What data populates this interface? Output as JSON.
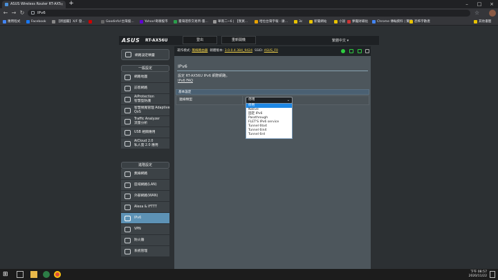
{
  "browser": {
    "tab_title": "ASUS Wireless Router RT-AX5",
    "url": "IPv6",
    "bookmarks": [
      "應用程式",
      "Facebook",
      "【新國屬】X/F 發...",
      "Goodinfo!台灣股...",
      "Yahoo!奇摩股市",
      "臺灣證券交易所-臺...",
      "華南二~6 | 【我買...",
      "哈拉台灣字報 - 康...",
      "3c",
      "新聞網站",
      "小說",
      "夢魘財補帖",
      "Chrome 傳輸資料 | 實家",
      "恐怖字數產",
      "其他書籤"
    ],
    "colors": {
      "tab_bg": "#35363a",
      "chrome_bg": "#202124"
    }
  },
  "router": {
    "brand": "ASUS",
    "model": "RT-AX56U",
    "header_buttons": [
      "登出",
      "重新開機"
    ],
    "language": "繁體中文",
    "status": {
      "op_mode_label": "運作模式:",
      "op_mode": "無線路由器",
      "firmware_label": "韌體版本:",
      "firmware": "3.0.0.4.384_9424",
      "ssid_label": "SSID:",
      "ssid": "ASUS_F0"
    },
    "sidebar": {
      "quick": "網路設定精靈",
      "general_header": "一般設定",
      "general": [
        {
          "label": "網路地圖",
          "icon": "network-map-icon"
        },
        {
          "label": "訪客網路",
          "icon": "guest-network-icon"
        },
        {
          "label": "AiProtection\n智慧型防護",
          "icon": "aiprotection-icon"
        },
        {
          "label": "智慧頻寬管理 Adaptive\nQoS",
          "icon": "qos-icon"
        },
        {
          "label": "Traffic Analyzer\n流量分析",
          "icon": "traffic-icon"
        },
        {
          "label": "USB 相關應用",
          "icon": "usb-icon"
        },
        {
          "label": "AiCloud 2.0\n私人雲 2.0 應用",
          "icon": "aicloud-icon"
        }
      ],
      "advanced_header": "進階設定",
      "advanced": [
        {
          "label": "無線網路",
          "icon": "wireless-icon"
        },
        {
          "label": "區域網路(LAN)",
          "icon": "lan-icon"
        },
        {
          "label": "外部網路(WAN)",
          "icon": "wan-icon"
        },
        {
          "label": "Alexa & IFTTT",
          "icon": "alexa-icon"
        },
        {
          "label": "IPv6",
          "icon": "ipv6-icon"
        },
        {
          "label": "VPN",
          "icon": "vpn-icon"
        },
        {
          "label": "防火牆",
          "icon": "firewall-icon"
        },
        {
          "label": "系統管理",
          "icon": "admin-icon"
        }
      ]
    },
    "page": {
      "title": "IPv6",
      "desc_line1": "設定 RT-AX56U IPv6 網際網路。",
      "faq": "IPv6 FAQ",
      "section": "基本設定",
      "conn_type_label": "連線類型",
      "conn_type_value": "停用",
      "options": [
        "停用",
        "Native",
        "固定 IPv6",
        "Passthrough",
        "FLET'S IPv6 service",
        "Tunnel 6to4",
        "Tunnel 6in4",
        "Tunnel 6rd"
      ],
      "highlight_index": 0
    }
  },
  "taskbar": {
    "time": "下午 08:57",
    "date": "2020/11/22"
  }
}
